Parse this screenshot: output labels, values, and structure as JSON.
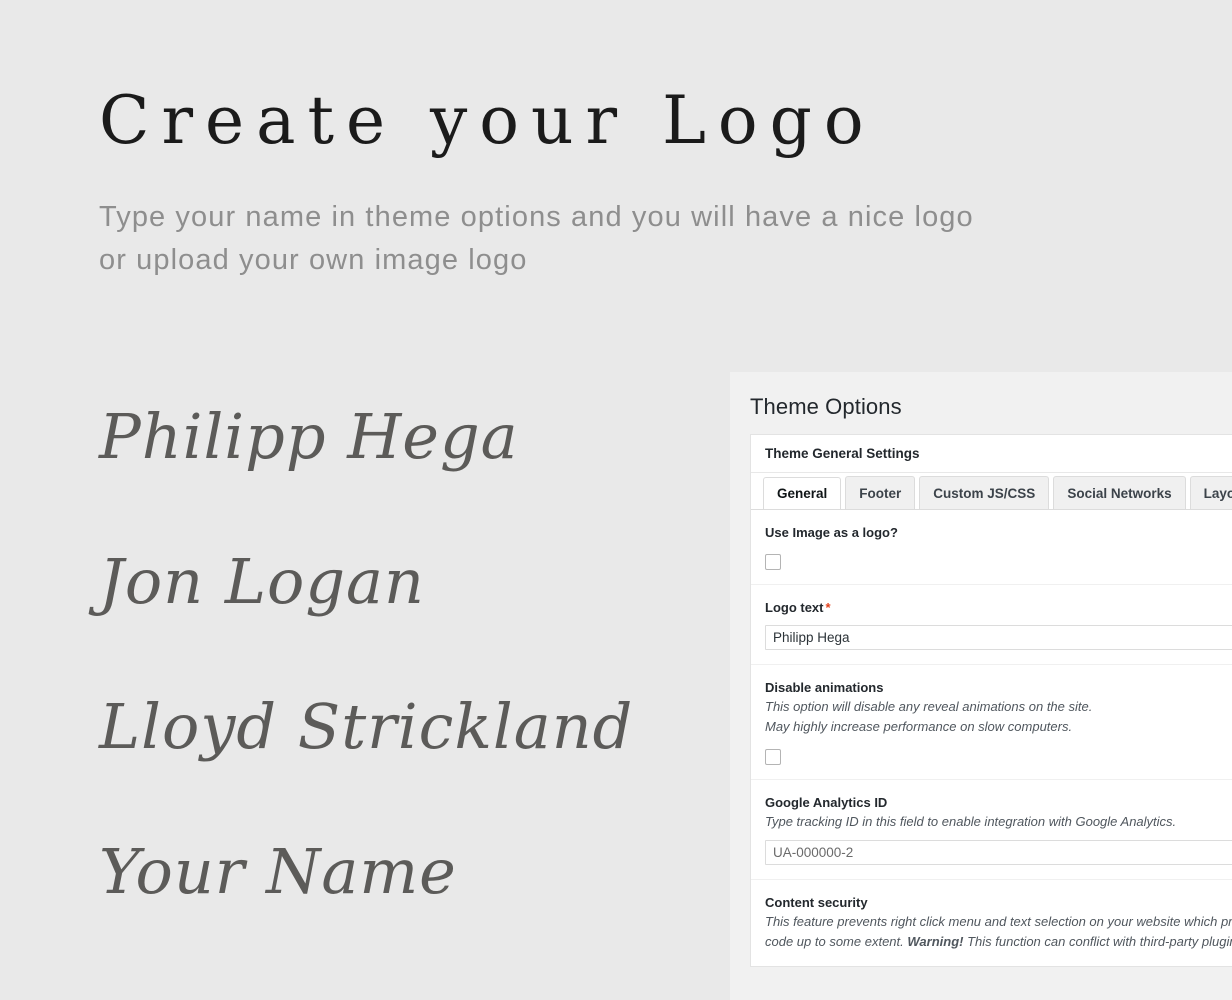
{
  "showcase": {
    "title": "Create your Logo",
    "subtitle": "Type your name in theme options and you will have a nice logo or upload your own image logo",
    "title_color": "#1b1b1b",
    "subtitle_color": "#8e8e8e",
    "sample_color": "#5c5b59",
    "background_color": "#e9e9e9",
    "samples": [
      {
        "text": "Philipp Hega"
      },
      {
        "text": "Jon Logan"
      },
      {
        "text": "Lloyd Strickland"
      },
      {
        "text": "Your Name"
      }
    ]
  },
  "theme_panel": {
    "heading": "Theme Options",
    "card_title": "Theme General Settings",
    "panel_background": "#f1f1f1",
    "card_background": "#ffffff",
    "required_marker_color": "#e2401c",
    "tabs": [
      {
        "label": "General",
        "active": true
      },
      {
        "label": "Footer",
        "active": false
      },
      {
        "label": "Custom JS/CSS",
        "active": false
      },
      {
        "label": "Social Networks",
        "active": false
      },
      {
        "label": "Layout",
        "active": false
      }
    ],
    "fields": {
      "use_image_as_logo": {
        "label": "Use Image as a logo?",
        "checked": false
      },
      "logo_text": {
        "label": "Logo text",
        "required_marker": "*",
        "value": "Philipp Hega"
      },
      "disable_animations": {
        "label": "Disable animations",
        "desc_line_1": "This option will disable any reveal animations on the site.",
        "desc_line_2": "May highly increase performance on slow computers.",
        "checked": false
      },
      "google_analytics_id": {
        "label": "Google Analytics ID",
        "desc_line_1": "Type tracking ID in this field to enable integration with Google Analytics.",
        "placeholder": "UA-000000-2",
        "value": ""
      },
      "content_security": {
        "label": "Content security",
        "desc_line_1": "This feature prevents right click menu and text selection on your website which protects your",
        "desc_line_2_a": "code up to some extent. ",
        "desc_line_2_warning": "Warning!",
        "desc_line_2_b": " This function can conflict with third-party plugins."
      }
    }
  }
}
